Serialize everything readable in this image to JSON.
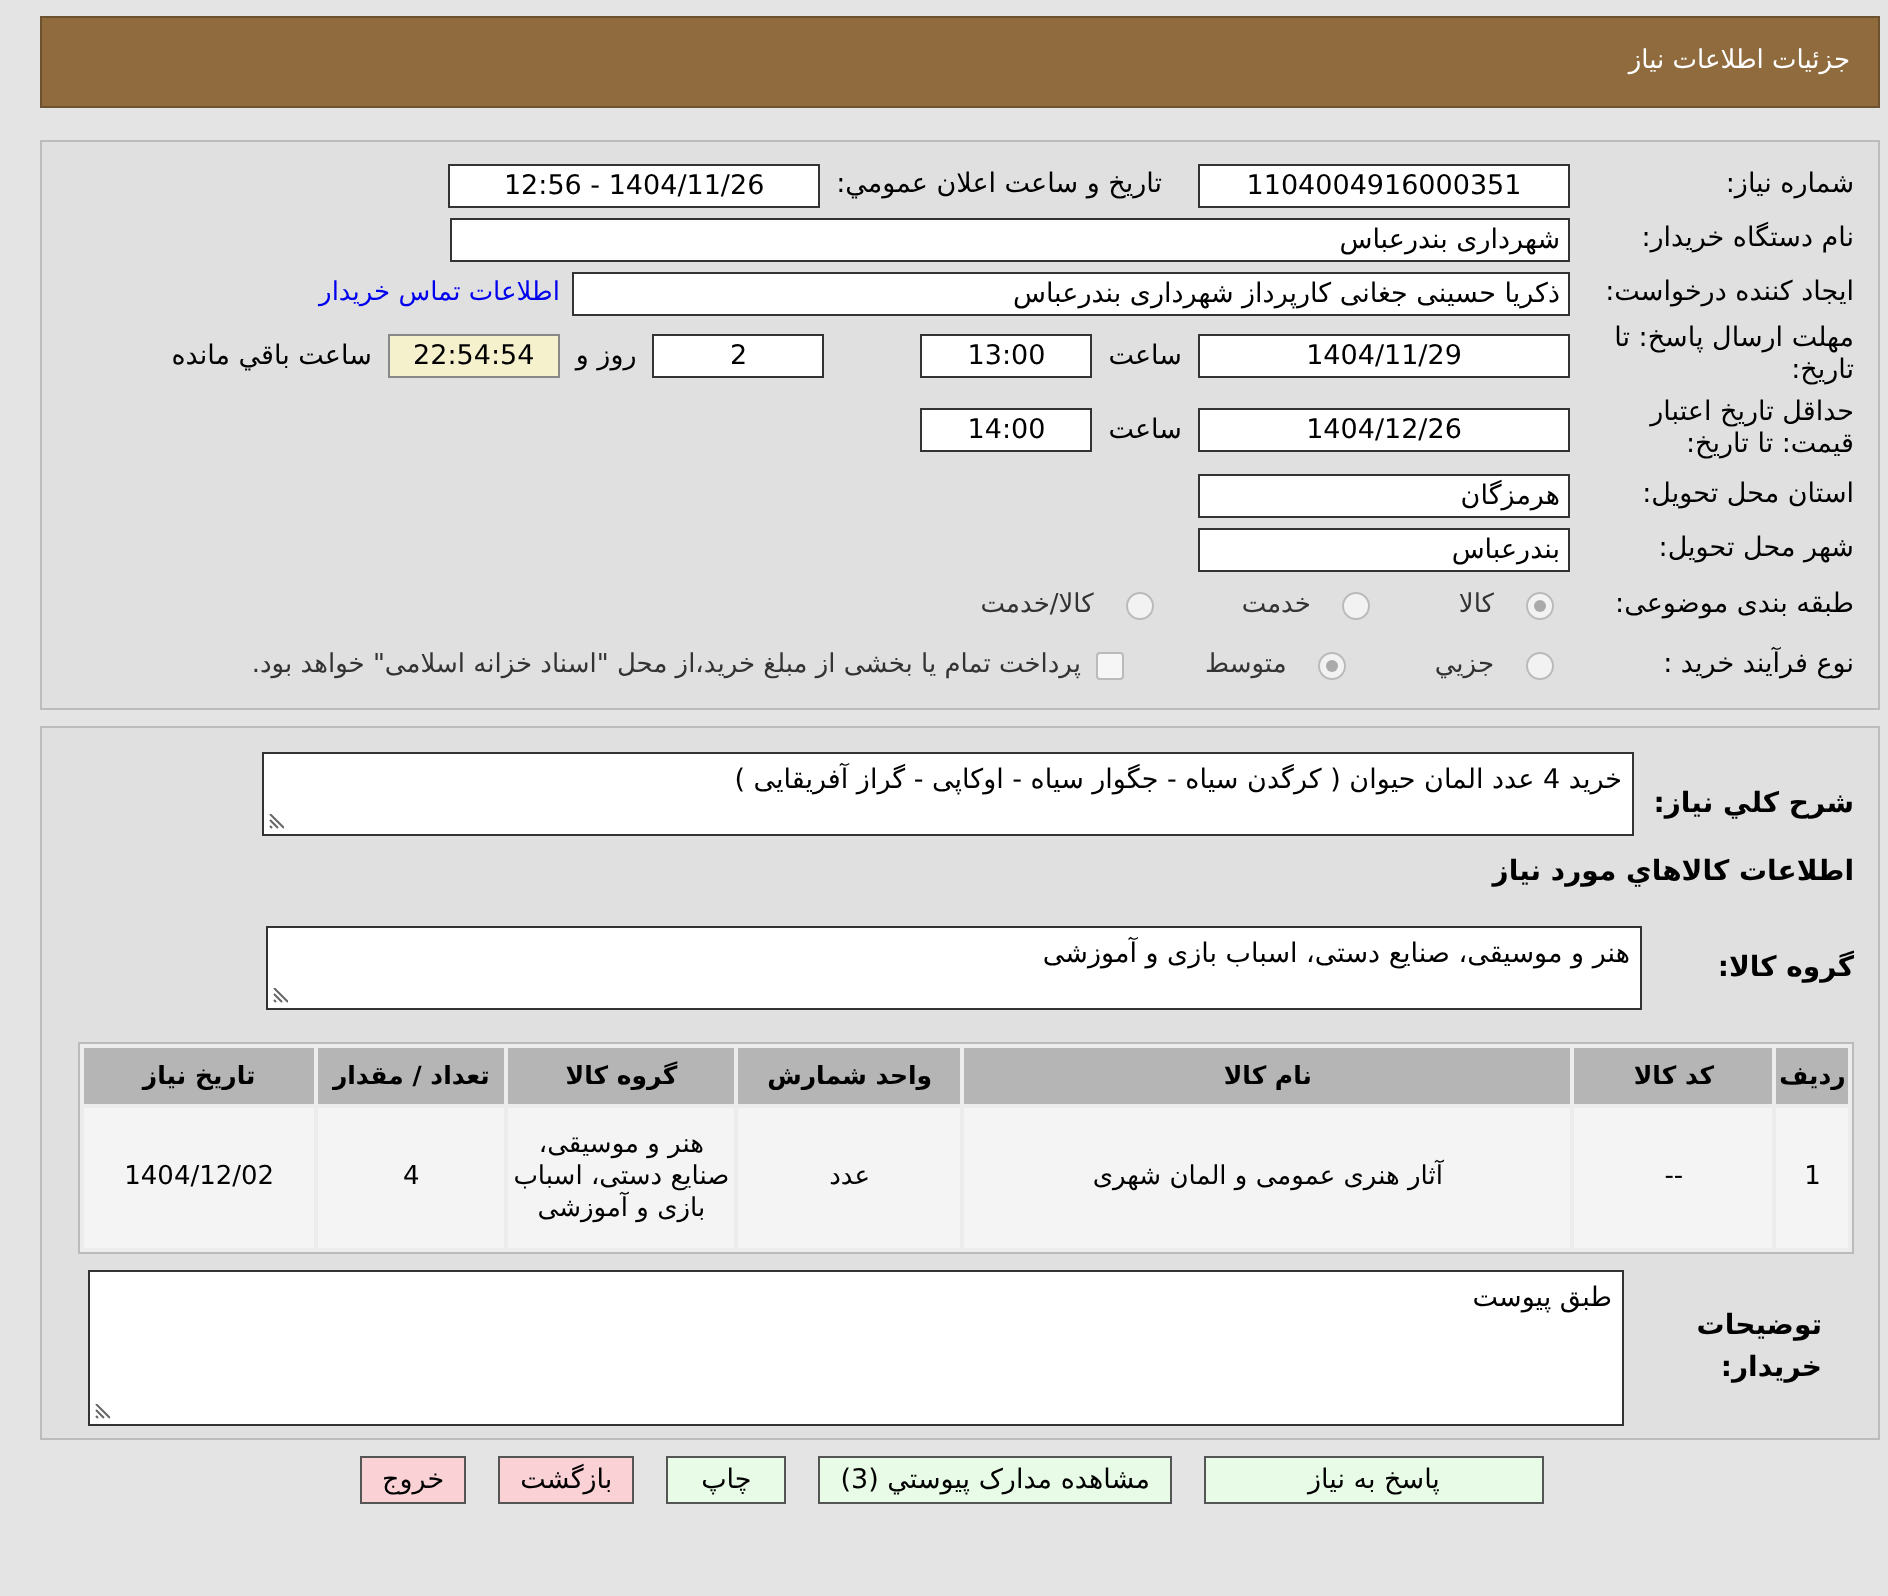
{
  "header": {
    "title": "جزئيات اطلاعات نياز"
  },
  "need_number": {
    "label": "شماره نیاز:",
    "value": "1104004916000351"
  },
  "announce": {
    "label": "تاريخ و ساعت اعلان عمومي:",
    "value": "1404/11/26 - 12:56"
  },
  "buyer": {
    "label": "نام دستگاه خریدار:",
    "value": "شهرداری بندرعباس"
  },
  "requester": {
    "label": "ایجاد کننده درخواست:",
    "value": "ذکریا حسینی جغانی کارپرداز شهرداری بندرعباس",
    "link": "اطلاعات تماس خریدار"
  },
  "deadline": {
    "label": "مهلت ارسال پاسخ: تا تاریخ:",
    "date": "1404/11/29",
    "time_label": "ساعت",
    "time": "13:00",
    "days": "2",
    "days_label": "روز و",
    "remaining": "22:54:54",
    "remaining_label": "ساعت باقي مانده"
  },
  "validity": {
    "label": "حداقل تاریخ اعتبار قیمت: تا تاریخ:",
    "date": "1404/12/26",
    "time_label": "ساعت",
    "time": "14:00"
  },
  "province": {
    "label": "استان محل تحویل:",
    "value": "هرمزگان"
  },
  "city": {
    "label": "شهر محل تحویل:",
    "value": "بندرعباس"
  },
  "category": {
    "label": "طبقه بندی موضوعی:",
    "options": [
      {
        "label": "کالا",
        "selected": true
      },
      {
        "label": "خدمت",
        "selected": false
      },
      {
        "label": "کالا/خدمت",
        "selected": false
      }
    ]
  },
  "process": {
    "label": "نوع فرآیند خرید :",
    "options": [
      {
        "label": "جزيي",
        "selected": false
      },
      {
        "label": "متوسط",
        "selected": true
      }
    ],
    "treasury": {
      "label": "پرداخت تمام يا بخشی از مبلغ خرید،از محل \"اسناد خزانه اسلامی\" خواهد بود.",
      "checked": false
    }
  },
  "summary": {
    "label": "شرح کلي نياز:",
    "value": "خرید 4 عدد المان حیوان ( کرگدن سیاه - جگوار سیاه - اوکاپی - گراز آفریقایی )"
  },
  "goods_title": "اطلاعات کالاهاي مورد نياز",
  "goods_group": {
    "label": "گروه کالا:",
    "value": "هنر و موسیقی، صنایع دستی، اسباب بازی و آموزشی"
  },
  "table": {
    "columns": [
      "رديف",
      "کد کالا",
      "نام کالا",
      "واحد شمارش",
      "گروه کالا",
      "تعداد / مقدار",
      "تاریخ نیاز"
    ],
    "rows": [
      [
        "1",
        "--",
        "آثار هنری عمومی و المان شهری",
        "عدد",
        "هنر و موسیقی، صنایع دستی، اسباب بازی و آموزشی",
        "4",
        "1404/12/02"
      ]
    ]
  },
  "notes": {
    "label": "توضیحات خریدار:",
    "value": "طبق پیوست"
  },
  "buttons": [
    {
      "label": "پاسخ به نياز",
      "kind": "normal"
    },
    {
      "label": "مشاهده مدارک پيوستي (3)",
      "kind": "normal"
    },
    {
      "label": "چاپ",
      "kind": "normal"
    },
    {
      "label": "بازگشت",
      "kind": "warning"
    },
    {
      "label": "خروج",
      "kind": "warning"
    }
  ]
}
